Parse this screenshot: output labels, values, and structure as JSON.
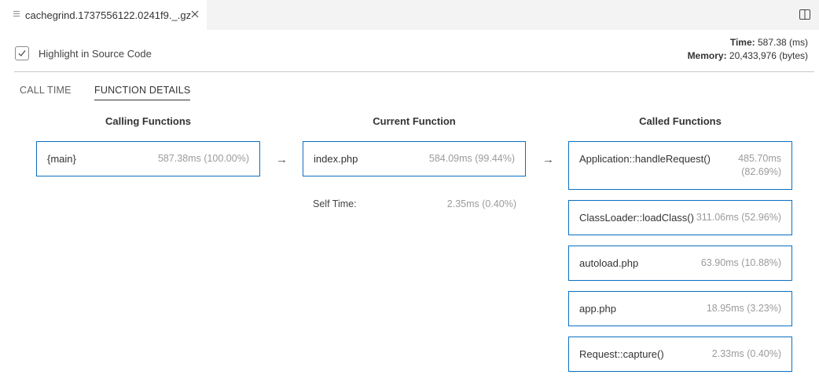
{
  "tab": {
    "title": "cachegrind.1737556122.0241f9._.gz"
  },
  "toolbar": {
    "highlight_label": "Highlight in Source Code"
  },
  "stats": {
    "time_label": "Time:",
    "time_value": "587.38 (ms)",
    "memory_label": "Memory:",
    "memory_value": "20,433,976 (bytes)"
  },
  "subtabs": [
    {
      "label": "CALL TIME",
      "active": false
    },
    {
      "label": "FUNCTION DETAILS",
      "active": true
    }
  ],
  "columns": {
    "calling": "Calling Functions",
    "current": "Current Function",
    "called": "Called Functions"
  },
  "calling": [
    {
      "name": "{main}",
      "value": "587.38ms (100.00%)"
    }
  ],
  "current": {
    "name": "index.php",
    "value": "584.09ms (99.44%)",
    "self_time_label": "Self Time:",
    "self_time_value": "2.35ms (0.40%)"
  },
  "called": [
    {
      "name": "Application::handleRequest()",
      "value": "485.70ms (82.69%)"
    },
    {
      "name": "ClassLoader::loadClass()",
      "value": "311.06ms (52.96%)"
    },
    {
      "name": "autoload.php",
      "value": "63.90ms (10.88%)"
    },
    {
      "name": "app.php",
      "value": "18.95ms (3.23%)"
    },
    {
      "name": "Request::capture()",
      "value": "2.33ms (0.40%)"
    }
  ],
  "arrow_glyph": "→",
  "icons": {
    "file": "file-lines-icon",
    "close": "close-icon",
    "split": "split-editor-icon",
    "check": "checkmark-icon"
  },
  "colors": {
    "accent": "#0a6fc2",
    "muted": "#9b9b9b"
  }
}
